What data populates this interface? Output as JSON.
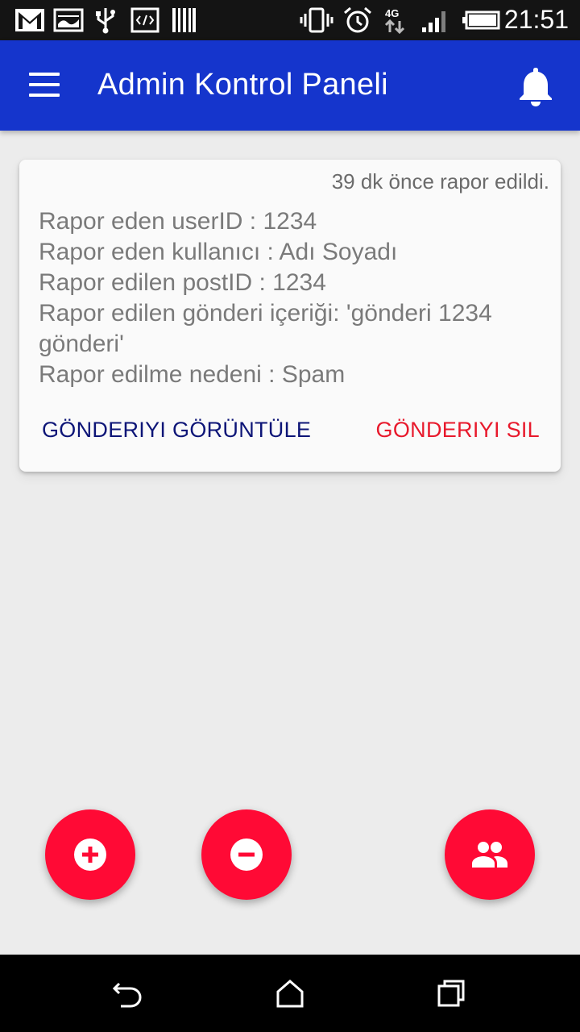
{
  "status_bar": {
    "time": "21:51",
    "network": "4G",
    "left_icons": [
      "gmail-icon",
      "image-icon",
      "usb-icon",
      "code-icon",
      "barcode-icon"
    ],
    "right_icons": [
      "vibrate-icon",
      "alarm-icon",
      "network-4g-icon",
      "signal-icon",
      "battery-icon"
    ]
  },
  "app_bar": {
    "title": "Admin Kontrol Paneli",
    "menu_icon": "menu-icon",
    "notification_icon": "bell-icon",
    "color": "#1535cc"
  },
  "report_card": {
    "time_ago": "39 dk önce rapor edildi.",
    "lines": [
      "Rapor eden userID : 1234",
      "Rapor eden kullanıcı : Adı Soyadı",
      "Rapor edilen postID : 1234",
      "Rapor edilen gönderi içeriği: 'gönderi 1234",
      "gönderi'",
      "Rapor edilme nedeni : Spam"
    ],
    "view_button": "GÖNDERIYI GÖRÜNTÜLE",
    "delete_button": "GÖNDERIYI SIL",
    "view_color": "#0d1577",
    "delete_color": "#e8192c"
  },
  "fabs": {
    "add_icon": "add-circle-icon",
    "remove_icon": "remove-circle-icon",
    "users_icon": "group-icon",
    "color": "#ff0a35"
  },
  "nav_bar": {
    "icons": [
      "back-icon",
      "home-icon",
      "recents-icon"
    ]
  }
}
